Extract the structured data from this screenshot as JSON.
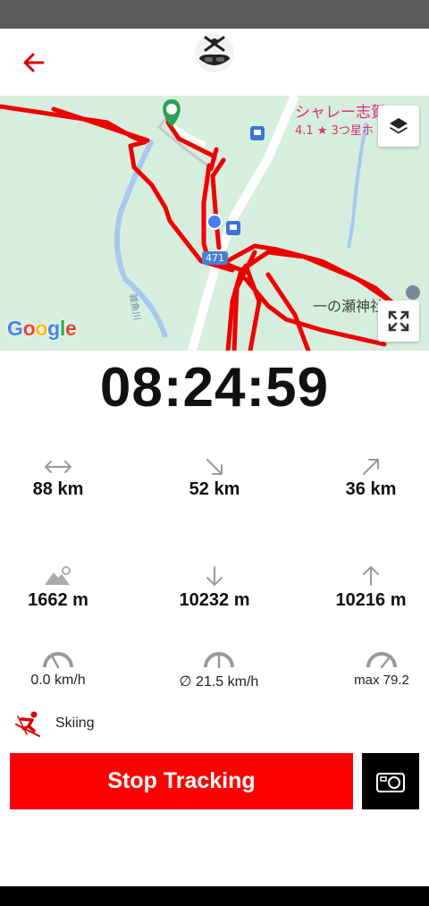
{
  "colors": {
    "accent": "#ff0000",
    "map_bg": "#d6eedd",
    "status_bar": "#5a5a5a"
  },
  "map": {
    "place_name": "シャレー志賀",
    "place_rating": "4.1 ★ 3つ星ホ",
    "shrine_label": "一の瀬神社",
    "route_shield": "471",
    "river_label": "雑魚川",
    "attribution": "Google"
  },
  "timer": "08:24:59",
  "stats": {
    "distance": "88 km",
    "downhill_distance": "52 km",
    "uphill_distance": "36 km",
    "altitude": "1662 m",
    "descent": "10232 m",
    "ascent": "10216 m",
    "current_speed": "0.0 km/h",
    "avg_speed": "∅ 21.5 km/h",
    "max_speed": "max 79.2"
  },
  "activity": {
    "label": "Skiing",
    "icon": "skier-icon"
  },
  "buttons": {
    "stop_tracking": "Stop Tracking"
  }
}
